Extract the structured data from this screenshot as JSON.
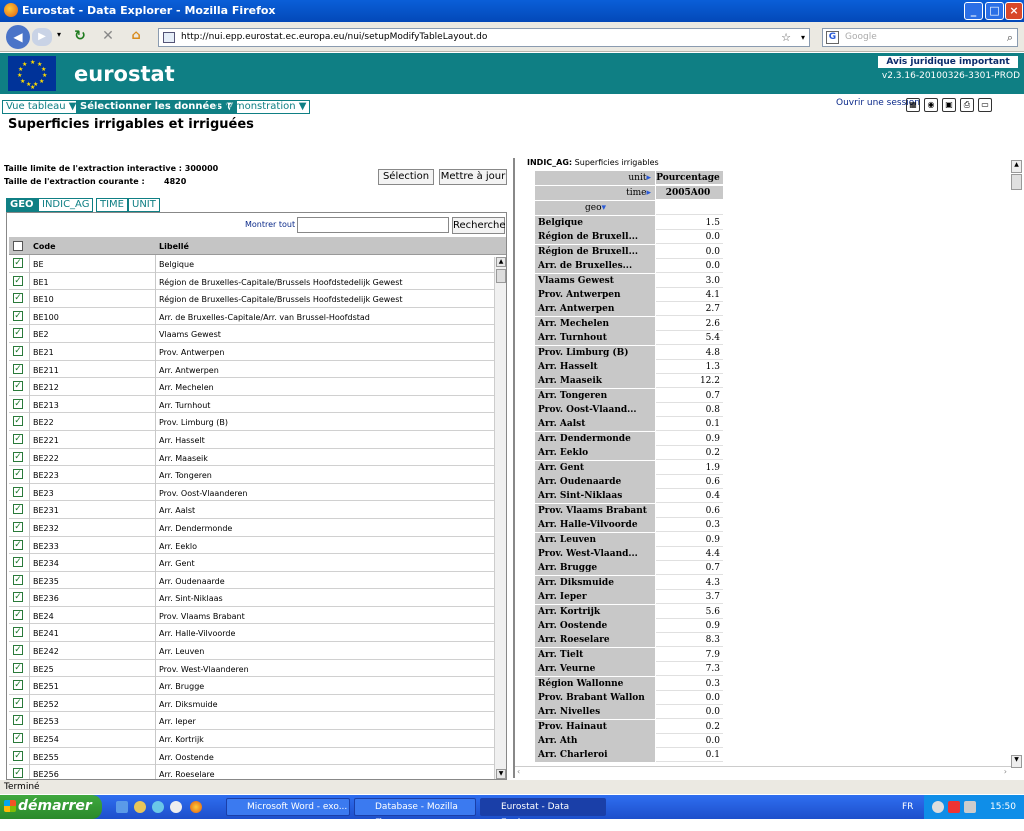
{
  "window": {
    "title": "Eurostat - Data Explorer - Mozilla Firefox"
  },
  "browser": {
    "url": "http://nui.epp.eurostat.ec.europa.eu/nui/setupModifyTableLayout.do",
    "search_placeholder": "Google"
  },
  "header": {
    "logo_text": "eurostat",
    "legal_link": "Avis juridique important",
    "version": "v2.3.16-20100326-3301-PROD"
  },
  "menu": {
    "items": [
      "Vue tableau ▼",
      "Sélectionner les données ▼",
      "Démonstration ▼"
    ],
    "session_link": "Ouvrir une session"
  },
  "page": {
    "title": "Superficies irrigables et irriguées"
  },
  "left": {
    "limit_label": "Taille limite de l'extraction interactive :",
    "limit_value": "300000",
    "current_label": "Taille de l'extraction courante :",
    "current_value": "4820",
    "selection_button": "Sélection",
    "update_button": "Mettre à jour",
    "tabs": [
      "GEO",
      "INDIC_AG",
      "TIME",
      "UNIT"
    ],
    "show_all": "Montrer tout",
    "search_button": "Recherche",
    "col_code": "Code",
    "col_label": "Libellé",
    "rows": [
      {
        "code": "BE",
        "label": "Belgique"
      },
      {
        "code": "BE1",
        "label": "Région de Bruxelles-Capitale/Brussels Hoofdstedelijk Gewest"
      },
      {
        "code": "BE10",
        "label": "Région de Bruxelles-Capitale/Brussels Hoofdstedelijk Gewest"
      },
      {
        "code": "BE100",
        "label": "Arr. de Bruxelles-Capitale/Arr. van Brussel-Hoofdstad"
      },
      {
        "code": "BE2",
        "label": "Vlaams Gewest"
      },
      {
        "code": "BE21",
        "label": "Prov. Antwerpen"
      },
      {
        "code": "BE211",
        "label": "Arr. Antwerpen"
      },
      {
        "code": "BE212",
        "label": "Arr. Mechelen"
      },
      {
        "code": "BE213",
        "label": "Arr. Turnhout"
      },
      {
        "code": "BE22",
        "label": "Prov. Limburg (B)"
      },
      {
        "code": "BE221",
        "label": "Arr. Hasselt"
      },
      {
        "code": "BE222",
        "label": "Arr. Maaseik"
      },
      {
        "code": "BE223",
        "label": "Arr. Tongeren"
      },
      {
        "code": "BE23",
        "label": "Prov. Oost-Vlaanderen"
      },
      {
        "code": "BE231",
        "label": "Arr. Aalst"
      },
      {
        "code": "BE232",
        "label": "Arr. Dendermonde"
      },
      {
        "code": "BE233",
        "label": "Arr. Eeklo"
      },
      {
        "code": "BE234",
        "label": "Arr. Gent"
      },
      {
        "code": "BE235",
        "label": "Arr. Oudenaarde"
      },
      {
        "code": "BE236",
        "label": "Arr. Sint-Niklaas"
      },
      {
        "code": "BE24",
        "label": "Prov. Vlaams Brabant"
      },
      {
        "code": "BE241",
        "label": "Arr. Halle-Vilvoorde"
      },
      {
        "code": "BE242",
        "label": "Arr. Leuven"
      },
      {
        "code": "BE25",
        "label": "Prov. West-Vlaanderen"
      },
      {
        "code": "BE251",
        "label": "Arr. Brugge"
      },
      {
        "code": "BE252",
        "label": "Arr. Diksmuide"
      },
      {
        "code": "BE253",
        "label": "Arr. Ieper"
      },
      {
        "code": "BE254",
        "label": "Arr. Kortrijk"
      },
      {
        "code": "BE255",
        "label": "Arr. Oostende"
      },
      {
        "code": "BE256",
        "label": "Arr. Roeselare"
      }
    ]
  },
  "right": {
    "indic_label": "INDIC_AG:",
    "indic_value": "Superficies irrigables",
    "unit_label": "unit",
    "unit_value": "Pourcentage",
    "time_label": "time",
    "time_value": "2005A00",
    "geo_label": "geo",
    "rows": [
      {
        "geo": "Belgique",
        "value": "1.5"
      },
      {
        "geo": "Région de Bruxell...",
        "value": "0.0"
      },
      {
        "geo": "Région de Bruxell...",
        "value": "0.0"
      },
      {
        "geo": "Arr. de Bruxelles...",
        "value": "0.0"
      },
      {
        "geo": "Vlaams Gewest",
        "value": "3.0"
      },
      {
        "geo": "Prov. Antwerpen",
        "value": "4.1"
      },
      {
        "geo": "Arr. Antwerpen",
        "value": "2.7"
      },
      {
        "geo": "Arr. Mechelen",
        "value": "2.6"
      },
      {
        "geo": "Arr. Turnhout",
        "value": "5.4"
      },
      {
        "geo": "Prov. Limburg (B)",
        "value": "4.8"
      },
      {
        "geo": "Arr. Hasselt",
        "value": "1.3"
      },
      {
        "geo": "Arr. Maaseik",
        "value": "12.2"
      },
      {
        "geo": "Arr. Tongeren",
        "value": "0.7"
      },
      {
        "geo": "Prov. Oost-Vlaand...",
        "value": "0.8"
      },
      {
        "geo": "Arr. Aalst",
        "value": "0.1"
      },
      {
        "geo": "Arr. Dendermonde",
        "value": "0.9"
      },
      {
        "geo": "Arr. Eeklo",
        "value": "0.2"
      },
      {
        "geo": "Arr. Gent",
        "value": "1.9"
      },
      {
        "geo": "Arr. Oudenaarde",
        "value": "0.6"
      },
      {
        "geo": "Arr. Sint-Niklaas",
        "value": "0.4"
      },
      {
        "geo": "Prov. Vlaams Brabant",
        "value": "0.6"
      },
      {
        "geo": "Arr. Halle-Vilvoorde",
        "value": "0.3"
      },
      {
        "geo": "Arr. Leuven",
        "value": "0.9"
      },
      {
        "geo": "Prov. West-Vlaand...",
        "value": "4.4"
      },
      {
        "geo": "Arr. Brugge",
        "value": "0.7"
      },
      {
        "geo": "Arr. Diksmuide",
        "value": "4.3"
      },
      {
        "geo": "Arr. Ieper",
        "value": "3.7"
      },
      {
        "geo": "Arr. Kortrijk",
        "value": "5.6"
      },
      {
        "geo": "Arr. Oostende",
        "value": "0.9"
      },
      {
        "geo": "Arr. Roeselare",
        "value": "8.3"
      },
      {
        "geo": "Arr. Tielt",
        "value": "7.9"
      },
      {
        "geo": "Arr. Veurne",
        "value": "7.3"
      },
      {
        "geo": "Région Wallonne",
        "value": "0.3"
      },
      {
        "geo": "Prov. Brabant Wallon",
        "value": "0.0"
      },
      {
        "geo": "Arr. Nivelles",
        "value": "0.0"
      },
      {
        "geo": "Prov. Hainaut",
        "value": "0.2"
      },
      {
        "geo": "Arr. Ath",
        "value": "0.0"
      },
      {
        "geo": "Arr. Charleroi",
        "value": "0.1"
      }
    ]
  },
  "status": {
    "text": "Terminé"
  },
  "taskbar": {
    "start": "démarrer",
    "tasks": [
      "Microsoft Word - exo...",
      "Database - Mozilla Fir...",
      "Eurostat - Data Explo..."
    ],
    "lang": "FR",
    "clock": "15:50"
  }
}
